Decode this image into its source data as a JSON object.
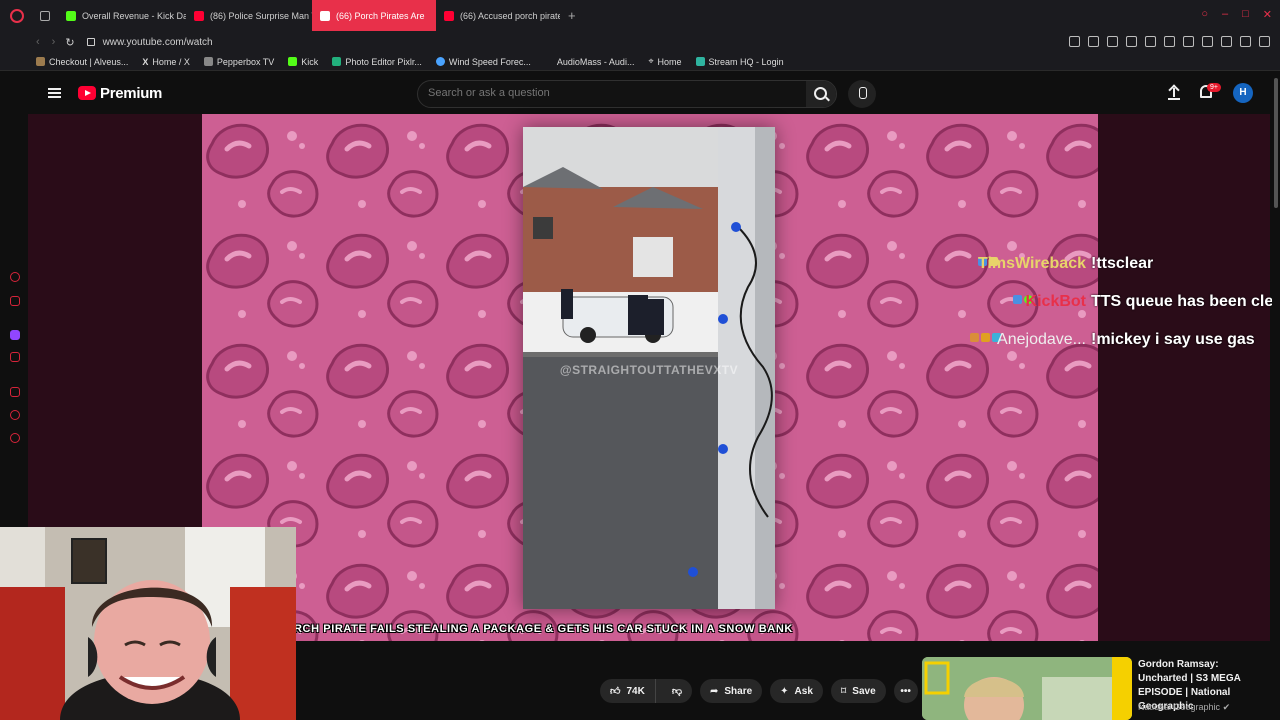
{
  "browser": {
    "tabs": [
      {
        "title": "Overall Revenue - Kick Das",
        "favicon_color": "#53fc18",
        "active": false
      },
      {
        "title": "(86) Police Surprise Man T",
        "favicon_color": "#ff0033",
        "active": false
      },
      {
        "title": "(66) Porch Pirates Are",
        "favicon_color": "#ffffff",
        "active": true
      },
      {
        "title": "(66) Accused porch pirate",
        "favicon_color": "#ff0033",
        "active": false
      }
    ],
    "url": "www.youtube.com/watch",
    "bookmarks": [
      {
        "label": "Checkout | Alveus...",
        "color": "#9c7b4e"
      },
      {
        "label": "Home / X",
        "color": "#ffffff"
      },
      {
        "label": "Pepperbox TV",
        "color": "#888888"
      },
      {
        "label": "Kick",
        "color": "#53fc18"
      },
      {
        "label": "Photo Editor Pixlr...",
        "color": "#22b07d"
      },
      {
        "label": "Wind Speed Forec...",
        "color": "#4aa3ff"
      },
      {
        "label": "AudioMass - Audi...",
        "color": "#1b1b1f"
      },
      {
        "label": "Home",
        "color": "#dddddd"
      },
      {
        "label": "Stream HQ - Login",
        "color": "#2fb4a0"
      }
    ]
  },
  "youtube": {
    "brand": "Premium",
    "search_placeholder": "Search or ask a question",
    "notification_count": "9+",
    "avatar_letter": "H"
  },
  "video": {
    "watermark": "@STRAIGHTOUTTATHEVXTV",
    "caption": "RCH PIRATE FAILS STEALING A PACKAGE & GETS HIS CAR STUCK IN A SNOW BANK",
    "chat": [
      {
        "user": "TimsWireback",
        "message": "!ttsclear",
        "user_color": "#e8d46a"
      },
      {
        "user": "KickBot",
        "message": "TTS queue has been cleared.",
        "user_color": "#e8304a"
      },
      {
        "user": "Anejodave...",
        "message": "!mickey i say use gas",
        "user_color": "#eeeeee"
      }
    ]
  },
  "actions": {
    "like_count": "74K",
    "share": "Share",
    "ask": "Ask",
    "save": "Save"
  },
  "up_next": {
    "title": "Gordon Ramsay: Uncharted | S3 MEGA EPISODE | National Geographic",
    "channel": "National Geographic"
  },
  "colors": {
    "accent": "#e8304a",
    "yt_red": "#ff0033",
    "stream_pink": "#cd5f93"
  }
}
